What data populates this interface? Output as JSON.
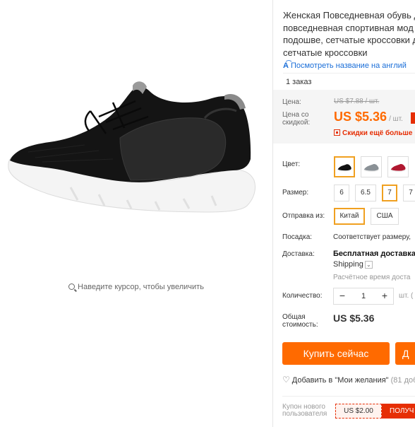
{
  "gallery": {
    "image_alt": "black sneaker",
    "zoom_hint": "Наведите курсор, чтобы увеличить"
  },
  "product": {
    "title_lines": [
      "Женская Повседневная обувь д",
      "повседневная спортивная мод",
      "подошве, сетчатые кроссовки д",
      "сетчатые кроссовки"
    ],
    "translate_link": "Посмотреть название на англий",
    "orders": "1 заказ"
  },
  "price": {
    "label_price": "Цена:",
    "old_price": "US $7.88 / шт.",
    "label_discount_price": "Цена со скидкой:",
    "new_price": "US $5.36",
    "per_unit": "/ шт.",
    "discount_note": "Скидки ещё больше"
  },
  "options": {
    "color_label": "Цвет:",
    "colors": [
      "black",
      "grey",
      "red"
    ],
    "size_label": "Размер:",
    "sizes": [
      "6",
      "6.5",
      "7",
      "7"
    ],
    "selected_size_index": 2,
    "ship_from_label": "Отправка из:",
    "ship_from": [
      "Китай",
      "США"
    ],
    "fit_label": "Посадка:",
    "fit_value": "Соответствует размеру,",
    "delivery_label": "Доставка:",
    "delivery_title": "Бесплатная доставка в",
    "delivery_method": "Shipping",
    "delivery_time": "Расчётное время доста"
  },
  "quantity": {
    "label": "Количество:",
    "value": "1",
    "minus": "−",
    "plus": "+",
    "unit": "шт. ("
  },
  "total": {
    "label": "Общая стоимость:",
    "value": "US $5.36"
  },
  "actions": {
    "buy_now": "Купить сейчас",
    "add_to_cart": "Д",
    "wishlist": "Добавить в \"Мои желания\"",
    "wishlist_count": "(81 доб"
  },
  "coupon": {
    "label": "Купон нового пользователя",
    "amount": "US $2.00",
    "get": "ПОЛУЧ"
  },
  "colors_ui": {
    "accent_orange": "#ff6a00",
    "selected_border": "#f0a020",
    "red": "#e62e04",
    "link_blue": "#1a6ed8"
  }
}
